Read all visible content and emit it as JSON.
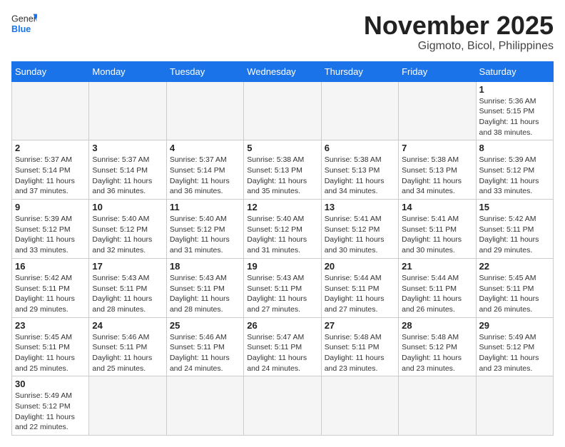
{
  "header": {
    "logo_general": "General",
    "logo_blue": "Blue",
    "month_title": "November 2025",
    "location": "Gigmoto, Bicol, Philippines"
  },
  "weekdays": [
    "Sunday",
    "Monday",
    "Tuesday",
    "Wednesday",
    "Thursday",
    "Friday",
    "Saturday"
  ],
  "days": [
    {
      "num": "",
      "info": ""
    },
    {
      "num": "",
      "info": ""
    },
    {
      "num": "",
      "info": ""
    },
    {
      "num": "",
      "info": ""
    },
    {
      "num": "",
      "info": ""
    },
    {
      "num": "",
      "info": ""
    },
    {
      "num": "1",
      "info": "Sunrise: 5:36 AM\nSunset: 5:15 PM\nDaylight: 11 hours\nand 38 minutes."
    },
    {
      "num": "2",
      "info": "Sunrise: 5:37 AM\nSunset: 5:14 PM\nDaylight: 11 hours\nand 37 minutes."
    },
    {
      "num": "3",
      "info": "Sunrise: 5:37 AM\nSunset: 5:14 PM\nDaylight: 11 hours\nand 36 minutes."
    },
    {
      "num": "4",
      "info": "Sunrise: 5:37 AM\nSunset: 5:14 PM\nDaylight: 11 hours\nand 36 minutes."
    },
    {
      "num": "5",
      "info": "Sunrise: 5:38 AM\nSunset: 5:13 PM\nDaylight: 11 hours\nand 35 minutes."
    },
    {
      "num": "6",
      "info": "Sunrise: 5:38 AM\nSunset: 5:13 PM\nDaylight: 11 hours\nand 34 minutes."
    },
    {
      "num": "7",
      "info": "Sunrise: 5:38 AM\nSunset: 5:13 PM\nDaylight: 11 hours\nand 34 minutes."
    },
    {
      "num": "8",
      "info": "Sunrise: 5:39 AM\nSunset: 5:12 PM\nDaylight: 11 hours\nand 33 minutes."
    },
    {
      "num": "9",
      "info": "Sunrise: 5:39 AM\nSunset: 5:12 PM\nDaylight: 11 hours\nand 33 minutes."
    },
    {
      "num": "10",
      "info": "Sunrise: 5:40 AM\nSunset: 5:12 PM\nDaylight: 11 hours\nand 32 minutes."
    },
    {
      "num": "11",
      "info": "Sunrise: 5:40 AM\nSunset: 5:12 PM\nDaylight: 11 hours\nand 31 minutes."
    },
    {
      "num": "12",
      "info": "Sunrise: 5:40 AM\nSunset: 5:12 PM\nDaylight: 11 hours\nand 31 minutes."
    },
    {
      "num": "13",
      "info": "Sunrise: 5:41 AM\nSunset: 5:12 PM\nDaylight: 11 hours\nand 30 minutes."
    },
    {
      "num": "14",
      "info": "Sunrise: 5:41 AM\nSunset: 5:11 PM\nDaylight: 11 hours\nand 30 minutes."
    },
    {
      "num": "15",
      "info": "Sunrise: 5:42 AM\nSunset: 5:11 PM\nDaylight: 11 hours\nand 29 minutes."
    },
    {
      "num": "16",
      "info": "Sunrise: 5:42 AM\nSunset: 5:11 PM\nDaylight: 11 hours\nand 29 minutes."
    },
    {
      "num": "17",
      "info": "Sunrise: 5:43 AM\nSunset: 5:11 PM\nDaylight: 11 hours\nand 28 minutes."
    },
    {
      "num": "18",
      "info": "Sunrise: 5:43 AM\nSunset: 5:11 PM\nDaylight: 11 hours\nand 28 minutes."
    },
    {
      "num": "19",
      "info": "Sunrise: 5:43 AM\nSunset: 5:11 PM\nDaylight: 11 hours\nand 27 minutes."
    },
    {
      "num": "20",
      "info": "Sunrise: 5:44 AM\nSunset: 5:11 PM\nDaylight: 11 hours\nand 27 minutes."
    },
    {
      "num": "21",
      "info": "Sunrise: 5:44 AM\nSunset: 5:11 PM\nDaylight: 11 hours\nand 26 minutes."
    },
    {
      "num": "22",
      "info": "Sunrise: 5:45 AM\nSunset: 5:11 PM\nDaylight: 11 hours\nand 26 minutes."
    },
    {
      "num": "23",
      "info": "Sunrise: 5:45 AM\nSunset: 5:11 PM\nDaylight: 11 hours\nand 25 minutes."
    },
    {
      "num": "24",
      "info": "Sunrise: 5:46 AM\nSunset: 5:11 PM\nDaylight: 11 hours\nand 25 minutes."
    },
    {
      "num": "25",
      "info": "Sunrise: 5:46 AM\nSunset: 5:11 PM\nDaylight: 11 hours\nand 24 minutes."
    },
    {
      "num": "26",
      "info": "Sunrise: 5:47 AM\nSunset: 5:11 PM\nDaylight: 11 hours\nand 24 minutes."
    },
    {
      "num": "27",
      "info": "Sunrise: 5:48 AM\nSunset: 5:11 PM\nDaylight: 11 hours\nand 23 minutes."
    },
    {
      "num": "28",
      "info": "Sunrise: 5:48 AM\nSunset: 5:12 PM\nDaylight: 11 hours\nand 23 minutes."
    },
    {
      "num": "29",
      "info": "Sunrise: 5:49 AM\nSunset: 5:12 PM\nDaylight: 11 hours\nand 23 minutes."
    },
    {
      "num": "30",
      "info": "Sunrise: 5:49 AM\nSunset: 5:12 PM\nDaylight: 11 hours\nand 22 minutes."
    },
    {
      "num": "",
      "info": ""
    },
    {
      "num": "",
      "info": ""
    },
    {
      "num": "",
      "info": ""
    },
    {
      "num": "",
      "info": ""
    },
    {
      "num": "",
      "info": ""
    },
    {
      "num": "",
      "info": ""
    }
  ]
}
